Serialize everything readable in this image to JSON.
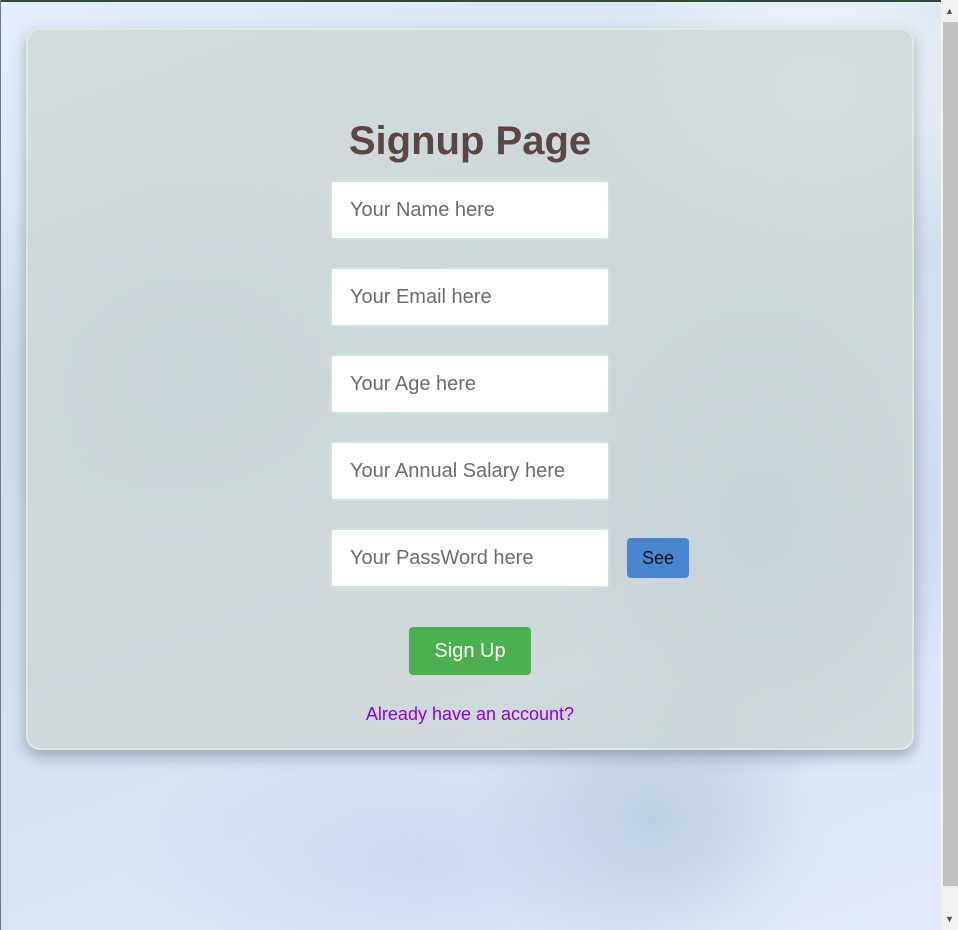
{
  "page": {
    "title": "Signup Page"
  },
  "form": {
    "name_placeholder": "Your Name here",
    "email_placeholder": "Your Email here",
    "age_placeholder": "Your Age here",
    "salary_placeholder": "Your Annual Salary here",
    "password_placeholder": "Your PassWord here",
    "see_label": "See",
    "signup_label": "Sign Up",
    "login_link": "Already have an account?"
  },
  "colors": {
    "title": "#5b4545",
    "see_button": "#4a86cf",
    "signup_button": "#4caf50",
    "link": "#8a00e6"
  },
  "icons": {
    "scroll_up": "scroll-up-arrow",
    "scroll_down": "scroll-down-arrow"
  }
}
